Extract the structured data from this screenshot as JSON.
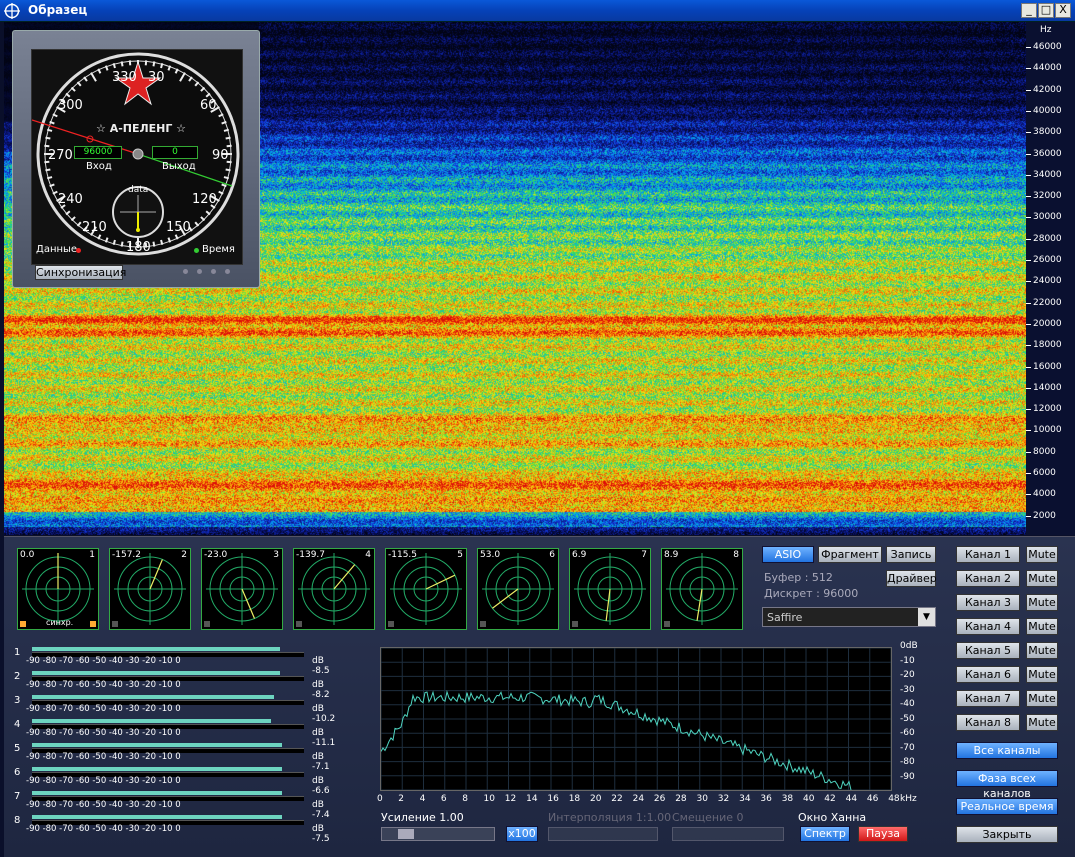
{
  "window": {
    "title": "Образец",
    "buttons": [
      "_",
      "□",
      "X"
    ]
  },
  "hz_axis": {
    "unit": "Hz",
    "labels": [
      "46000",
      "44000",
      "42000",
      "40000",
      "38000",
      "36000",
      "34000",
      "32000",
      "30000",
      "28000",
      "26000",
      "24000",
      "22000",
      "20000",
      "18000",
      "16000",
      "14000",
      "12000",
      "10000",
      "8000",
      "6000",
      "4000",
      "2000"
    ]
  },
  "dial": {
    "title": "☆ А-ПЕЛЕНГ ☆",
    "degrees": [
      "330",
      "30",
      "300",
      "60",
      "270",
      "90",
      "240",
      "120",
      "210",
      "150",
      "180"
    ],
    "input_value": "96000",
    "input_label": "Вход",
    "output_value": "0",
    "output_label": "Выход",
    "subdial_label": "data",
    "data_label": "Данные",
    "time_label": "Время",
    "sync_button": "Синхронизация"
  },
  "scopes": [
    {
      "value": "0.0",
      "num": "1",
      "caption": "синхр."
    },
    {
      "value": "-157.2",
      "num": "2"
    },
    {
      "value": "-23.0",
      "num": "3"
    },
    {
      "value": "-139.7",
      "num": "4"
    },
    {
      "value": "-115.5",
      "num": "5"
    },
    {
      "value": "53.0",
      "num": "6"
    },
    {
      "value": "6.9",
      "num": "7"
    },
    {
      "value": "8.9",
      "num": "8"
    }
  ],
  "audio": {
    "asio": "ASIO",
    "fragment": "Фрагмент",
    "record": "Запись",
    "driver": "Драйвер",
    "buffer": "Буфер     : 512",
    "discrete": "Дискрет : 96000",
    "device": "Saffire"
  },
  "meters": {
    "scale": "-90   -80   -70   -60   -50   -40   -30   -20   -10     0",
    "unit": "dB",
    "rows": [
      {
        "idx": "1",
        "db": "-8.5",
        "level": 0.91
      },
      {
        "idx": "2",
        "db": "-8.2",
        "level": 0.91
      },
      {
        "idx": "3",
        "db": "-10.2",
        "level": 0.89
      },
      {
        "idx": "4",
        "db": "-11.1",
        "level": 0.88
      },
      {
        "idx": "5",
        "db": "-7.1",
        "level": 0.92
      },
      {
        "idx": "6",
        "db": "-6.6",
        "level": 0.92
      },
      {
        "idx": "7",
        "db": "-7.4",
        "level": 0.92
      },
      {
        "idx": "8",
        "db": "-7.5",
        "level": 0.92
      }
    ]
  },
  "spectrum": {
    "x_ticks": [
      "0",
      "2",
      "4",
      "6",
      "8",
      "10",
      "12",
      "14",
      "16",
      "18",
      "20",
      "22",
      "24",
      "26",
      "28",
      "30",
      "32",
      "34",
      "36",
      "38",
      "40",
      "42",
      "44",
      "46",
      "48"
    ],
    "x_unit": "kHz",
    "y_ticks": [
      "0dB",
      "-10",
      "-20",
      "-30",
      "-40",
      "-50",
      "-60",
      "-70",
      "-80",
      "-90"
    ]
  },
  "controls": {
    "gain": "Усиление 1.00",
    "x100": "x100",
    "interp": "Интерполяция 1:1.00",
    "shift": "Смещение 0",
    "window": "Окно Ханна",
    "spectrum_btn": "Спектр",
    "pause_btn": "Пауза"
  },
  "channels": {
    "items": [
      "Канал 1",
      "Канал 2",
      "Канал 3",
      "Канал 4",
      "Канал 5",
      "Канал 6",
      "Канал 7",
      "Канал 8"
    ],
    "mute": "Mute",
    "all": "Все каналы",
    "phase": "Фаза всех каналов",
    "realtime": "Реальное время",
    "close": "Закрыть"
  }
}
